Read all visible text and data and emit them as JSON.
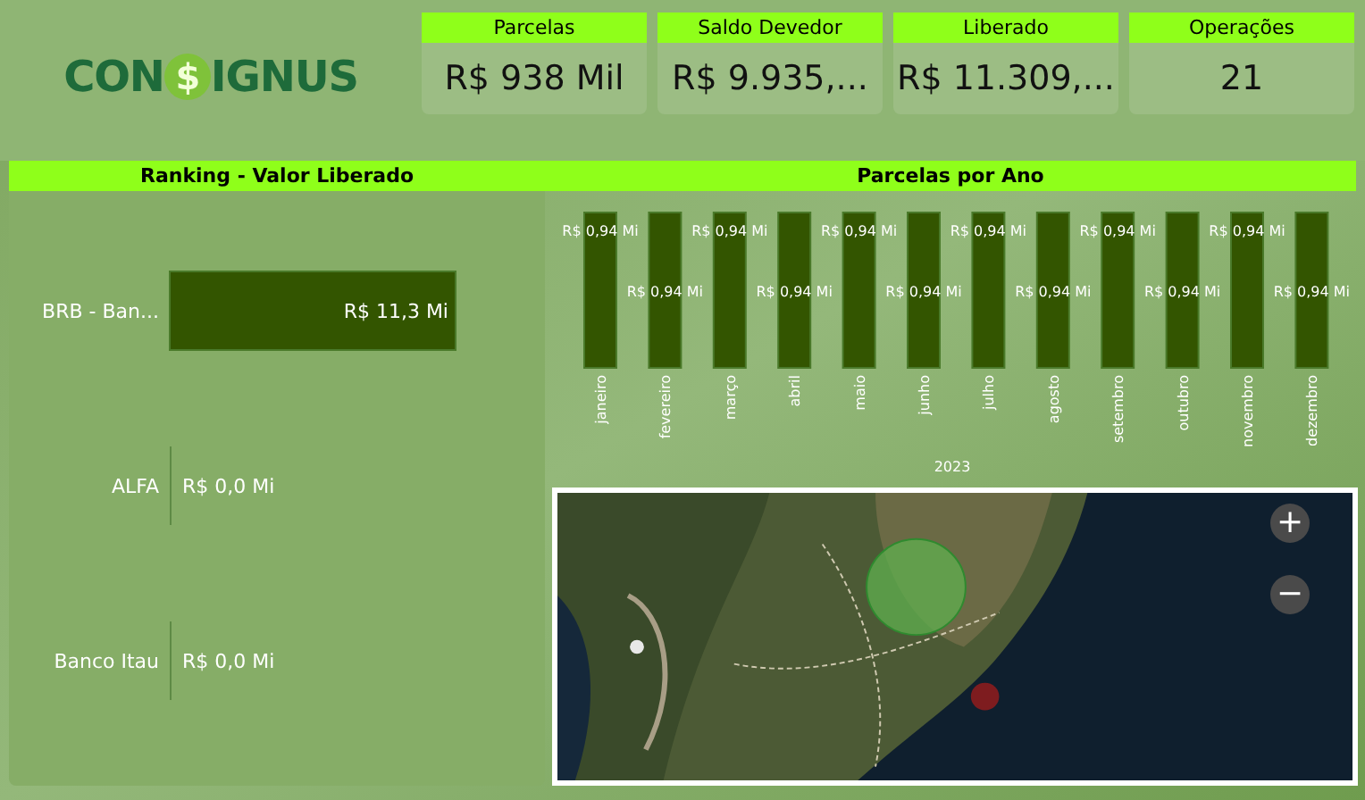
{
  "logo": {
    "left": "CON",
    "mark": "$",
    "right": "IGNUS"
  },
  "kpis": [
    {
      "label": "Parcelas",
      "value": "R$ 938 Mil"
    },
    {
      "label": "Saldo Devedor",
      "value": "R$ 9.935,..."
    },
    {
      "label": "Liberado",
      "value": "R$ 11.309,..."
    },
    {
      "label": "Operações",
      "value": "21"
    }
  ],
  "ranking": {
    "title": "Ranking - Valor Liberado",
    "chart_data": {
      "type": "bar",
      "orientation": "horizontal",
      "categories": [
        "BRB - Ban...",
        "ALFA",
        "Banco Itau"
      ],
      "values": [
        11.3,
        0,
        0
      ],
      "value_labels": [
        "R$ 11,3 Mi",
        "R$ 0,0 Mi",
        "R$ 0,0 Mi"
      ]
    }
  },
  "parcelas": {
    "title": "Parcelas por Ano",
    "chart_data": {
      "type": "bar",
      "xlabel": "2023",
      "categories": [
        "janeiro",
        "fevereiro",
        "março",
        "abril",
        "maio",
        "junho",
        "julho",
        "agosto",
        "setembro",
        "outubro",
        "novembro",
        "dezembro"
      ],
      "values": [
        0.94,
        0.94,
        0.94,
        0.94,
        0.94,
        0.94,
        0.94,
        0.94,
        0.94,
        0.94,
        0.94,
        0.94
      ],
      "value_labels": [
        "R$ 0,94 Mi",
        "R$ 0,94 Mi",
        "R$ 0,94 Mi",
        "R$ 0,94 Mi",
        "R$ 0,94 Mi",
        "R$ 0,94 Mi",
        "R$ 0,94 Mi",
        "R$ 0,94 Mi",
        "R$ 0,94 Mi",
        "R$ 0,94 Mi",
        "R$ 0,94 Mi",
        "R$ 0,94 Mi"
      ]
    }
  },
  "map": {
    "kind": "picture",
    "zoom_in": "+",
    "zoom_out": "−"
  }
}
